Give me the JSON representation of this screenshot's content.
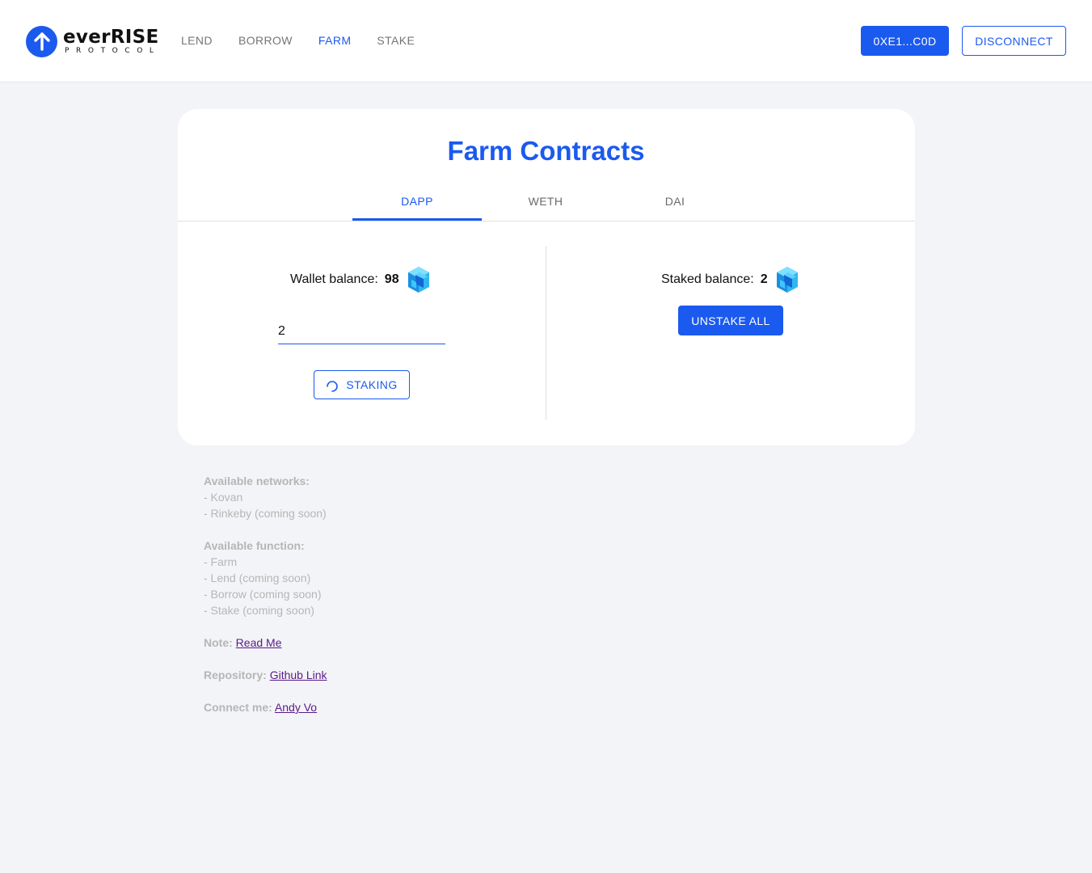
{
  "header": {
    "logo": {
      "name": "everRISE",
      "subtitle": "PROTOCOL"
    },
    "nav": [
      {
        "label": "LEND",
        "active": false
      },
      {
        "label": "BORROW",
        "active": false
      },
      {
        "label": "FARM",
        "active": true
      },
      {
        "label": "STAKE",
        "active": false
      }
    ],
    "address_label": "0XE1...C0D",
    "disconnect_label": "DISCONNECT"
  },
  "card": {
    "title": "Farm Contracts",
    "tabs": [
      {
        "label": "DAPP",
        "active": true
      },
      {
        "label": "WETH",
        "active": false
      },
      {
        "label": "DAI",
        "active": false
      }
    ],
    "wallet": {
      "label": "Wallet balance:",
      "value": "98",
      "token_icon": "dapp-token-icon"
    },
    "stake_input_value": "2",
    "staking_button": "STAKING",
    "staked": {
      "label": "Staked balance:",
      "value": "2",
      "token_icon": "dapp-token-icon"
    },
    "unstake_button": "UNSTAKE ALL"
  },
  "info": {
    "networks_head": "Available networks:",
    "networks": [
      "- Kovan",
      "- Rinkeby (coming soon)"
    ],
    "functions_head": "Available function:",
    "functions": [
      "- Farm",
      "- Lend (coming soon)",
      "- Borrow (coming soon)",
      "- Stake (coming soon)"
    ],
    "note_head": "Note:",
    "note_link": "Read Me",
    "repo_head": "Repository:",
    "repo_link": "Github Link",
    "connect_head": "Connect me:",
    "connect_link": "Andy Vo"
  },
  "colors": {
    "accent": "#1b5aee",
    "background": "#f3f4f7",
    "muted_text": "#b6b6b6",
    "link": "#5a1a8a"
  }
}
